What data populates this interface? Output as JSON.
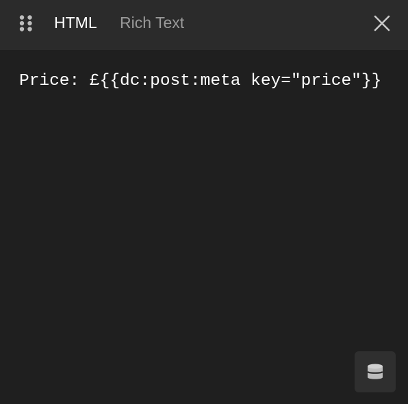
{
  "header": {
    "drag_icon": "drag-handle-icon",
    "tabs": [
      {
        "label": "HTML",
        "active": true
      },
      {
        "label": "Rich Text",
        "active": false
      }
    ],
    "close_icon": "close-icon"
  },
  "editor": {
    "content": "Price: £{{dc:post:meta key=\"price\"}}"
  },
  "footer": {
    "dynamic_data_icon": "database-icon"
  },
  "colors": {
    "background": "#1f1f1f",
    "header_background": "#2b2b2b",
    "active_tab": "#ffffff",
    "inactive_tab": "#9a9a9a",
    "icon": "#bdbdbd"
  }
}
